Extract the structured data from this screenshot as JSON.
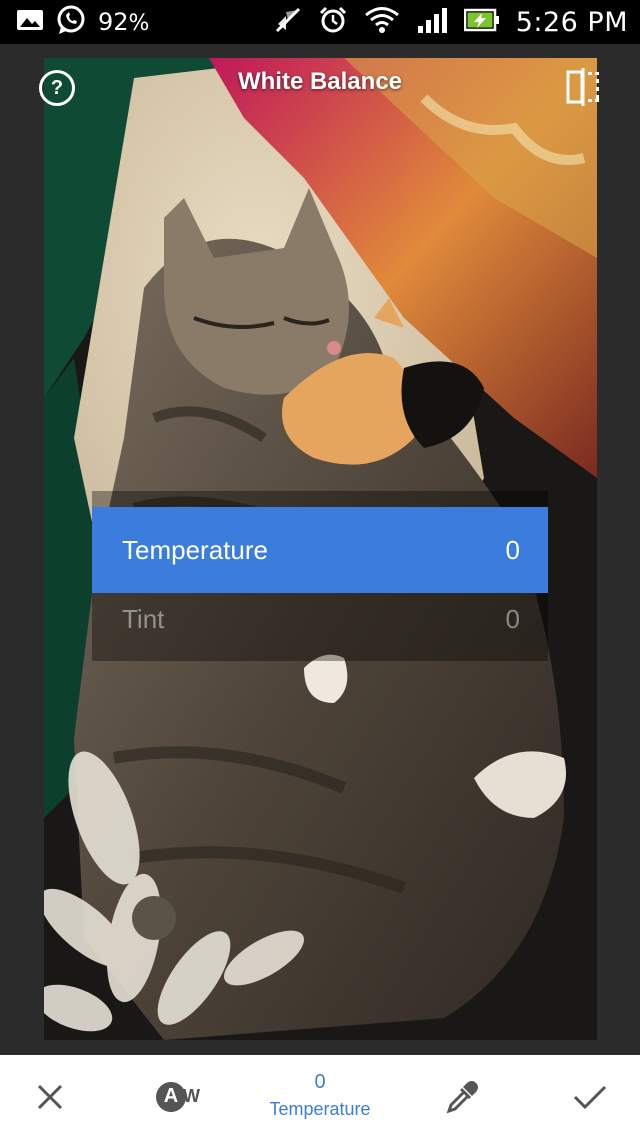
{
  "status_bar": {
    "battery_percent_text": "92",
    "battery_percent_sign": "%",
    "time": "5:26 PM",
    "icons": [
      "gallery-icon",
      "whatsapp-icon",
      "muted-icon",
      "alarm-icon",
      "wifi-icon",
      "signal-icon",
      "battery-charging-icon"
    ]
  },
  "header": {
    "help_label": "?",
    "title": "White Balance",
    "compare_icon": "compare-icon"
  },
  "adjust_menu": {
    "items": [
      {
        "label": "Temperature",
        "value": "0"
      },
      {
        "label": "Tint",
        "value": "0"
      }
    ]
  },
  "toolbar": {
    "cancel_icon": "close-icon",
    "auto_wb_label": "A",
    "auto_wb_suffix": "W",
    "current_value": "0",
    "current_label": "Temperature",
    "picker_icon": "eyedropper-icon",
    "apply_icon": "check-icon"
  },
  "colors": {
    "accent": "#3b7ddd",
    "statusbar_bg": "#000000",
    "canvas_bg": "#2b2b2b",
    "toolbar_bg": "#ffffff",
    "toolbar_icon": "#555555",
    "battery_green": "#7cc430"
  }
}
